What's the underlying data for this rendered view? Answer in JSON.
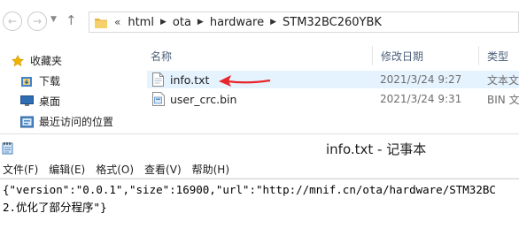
{
  "explorer": {
    "breadcrumb_prefix": "«",
    "breadcrumb": [
      "html",
      "ota",
      "hardware",
      "STM32BC260YBK"
    ],
    "sidebar": [
      {
        "label": "收藏夹",
        "icon": "star-icon"
      },
      {
        "label": "下载",
        "icon": "download-folder-icon"
      },
      {
        "label": "桌面",
        "icon": "desktop-icon"
      },
      {
        "label": "最近访问的位置",
        "icon": "recent-places-icon"
      }
    ],
    "columns": {
      "name": "名称",
      "modified": "修改日期",
      "type": "类型"
    },
    "files": [
      {
        "name": "info.txt",
        "modified": "2021/3/24 9:27",
        "type": "文本文",
        "icon": "text-file-icon"
      },
      {
        "name": "user_crc.bin",
        "modified": "2021/3/24 9:31",
        "type": "BIN 文",
        "icon": "bin-file-icon"
      }
    ],
    "annotation_color": "#e8262b"
  },
  "notepad": {
    "title": "info.txt - 记事本",
    "menu": [
      "文件(F)",
      "编辑(E)",
      "格式(O)",
      "查看(V)",
      "帮助(H)"
    ],
    "lines": [
      "{\"version\":\"0.0.1\",\"size\":16900,\"url\":\"http://mnif.cn/ota/hardware/STM32BC",
      "2.优化了部分程序\"}"
    ]
  }
}
